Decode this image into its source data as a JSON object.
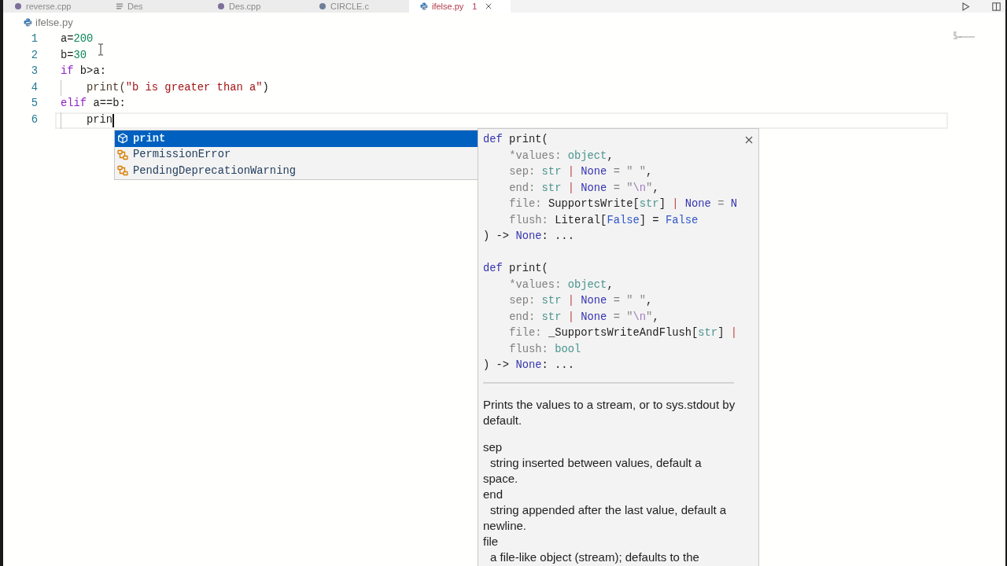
{
  "tabs": [
    {
      "label": "reverse.cpp",
      "kind": "cpp",
      "selected": false
    },
    {
      "label": "Des",
      "kind": "text",
      "selected": false
    },
    {
      "label": "Des.cpp",
      "kind": "cpp",
      "selected": false
    },
    {
      "label": "CIRCLE.c",
      "kind": "c",
      "selected": false
    },
    {
      "label": "ifelse.py",
      "kind": "python",
      "selected": true,
      "problems": "1"
    }
  ],
  "breadcrumb": {
    "file": "ifelse.py"
  },
  "editor": {
    "lines": [
      {
        "number": "1",
        "current": false,
        "indented": false,
        "tokens": [
          {
            "text": "a=",
            "kind": "plain"
          },
          {
            "text": "200",
            "kind": "number"
          }
        ]
      },
      {
        "number": "2",
        "current": false,
        "indented": false,
        "tokens": [
          {
            "text": "b=",
            "kind": "plain"
          },
          {
            "text": "30",
            "kind": "number"
          }
        ]
      },
      {
        "number": "3",
        "current": false,
        "indented": false,
        "tokens": [
          {
            "text": "if",
            "kind": "keyword"
          },
          {
            "text": " b>a:",
            "kind": "plain"
          }
        ]
      },
      {
        "number": "4",
        "current": false,
        "indented": true,
        "tokens": [
          {
            "text": "print(",
            "kind": "function"
          },
          {
            "text": "\"b is greater than a\"",
            "kind": "string"
          },
          {
            "text": ")",
            "kind": "plain"
          }
        ]
      },
      {
        "number": "5",
        "current": false,
        "indented": false,
        "tokens": [
          {
            "text": "elif",
            "kind": "keyword"
          },
          {
            "text": " a==b:",
            "kind": "plain"
          }
        ]
      },
      {
        "number": "6",
        "current": true,
        "indented": true,
        "tokens": [
          {
            "text": "prin",
            "kind": "plain"
          }
        ]
      }
    ]
  },
  "suggest_widget": {
    "items": [
      {
        "label": "print",
        "kind": "function",
        "selected": true
      },
      {
        "label": "PermissionError",
        "kind": "class",
        "selected": false
      },
      {
        "label": "PendingDeprecationWarning",
        "kind": "class",
        "selected": false
      }
    ]
  },
  "details_panel": {
    "signatures": [
      {
        "lines": [
          {
            "indented": false,
            "tokens": [
              {
                "text": "def",
                "kind": "keyword"
              },
              {
                "text": " print(",
                "kind": "plain"
              }
            ]
          },
          {
            "indented": true,
            "tokens": [
              {
                "text": "*values: ",
                "kind": "param"
              },
              {
                "text": "object",
                "kind": "type"
              },
              {
                "text": ",",
                "kind": "plain"
              }
            ]
          },
          {
            "indented": true,
            "tokens": [
              {
                "text": "sep: ",
                "kind": "param"
              },
              {
                "text": "str",
                "kind": "type"
              },
              {
                "text": " | ",
                "kind": "op"
              },
              {
                "text": "None",
                "kind": "keyword"
              },
              {
                "text": " = ",
                "kind": "punct"
              },
              {
                "text": "\" \"",
                "kind": "string"
              },
              {
                "text": ",",
                "kind": "plain"
              }
            ]
          },
          {
            "indented": true,
            "tokens": [
              {
                "text": "end: ",
                "kind": "param"
              },
              {
                "text": "str",
                "kind": "type"
              },
              {
                "text": " | ",
                "kind": "op"
              },
              {
                "text": "None",
                "kind": "keyword"
              },
              {
                "text": " = ",
                "kind": "punct"
              },
              {
                "text": "\"",
                "kind": "string"
              },
              {
                "text": "\\n",
                "kind": "escape"
              },
              {
                "text": "\"",
                "kind": "string"
              },
              {
                "text": ",",
                "kind": "plain"
              }
            ]
          },
          {
            "indented": true,
            "tokens": [
              {
                "text": "file: ",
                "kind": "param"
              },
              {
                "text": "SupportsWrite[",
                "kind": "plain"
              },
              {
                "text": "str",
                "kind": "type"
              },
              {
                "text": "]",
                "kind": "plain"
              },
              {
                "text": " | ",
                "kind": "op"
              },
              {
                "text": "None",
                "kind": "keyword"
              },
              {
                "text": " = ",
                "kind": "punct"
              },
              {
                "text": "N",
                "kind": "keyword"
              }
            ]
          },
          {
            "indented": true,
            "tokens": [
              {
                "text": "flush: ",
                "kind": "param"
              },
              {
                "text": "Literal[",
                "kind": "plain"
              },
              {
                "text": "False",
                "kind": "constant"
              },
              {
                "text": "] = ",
                "kind": "plain"
              },
              {
                "text": "False",
                "kind": "constant"
              }
            ]
          },
          {
            "indented": false,
            "tokens": [
              {
                "text": ") -> ",
                "kind": "plain"
              },
              {
                "text": "None",
                "kind": "keyword"
              },
              {
                "text": ": ...",
                "kind": "plain"
              }
            ]
          }
        ]
      },
      {
        "lines": [
          {
            "indented": false,
            "tokens": [
              {
                "text": "def",
                "kind": "keyword"
              },
              {
                "text": " print(",
                "kind": "plain"
              }
            ]
          },
          {
            "indented": true,
            "tokens": [
              {
                "text": "*values: ",
                "kind": "param"
              },
              {
                "text": "object",
                "kind": "type"
              },
              {
                "text": ",",
                "kind": "plain"
              }
            ]
          },
          {
            "indented": true,
            "tokens": [
              {
                "text": "sep: ",
                "kind": "param"
              },
              {
                "text": "str",
                "kind": "type"
              },
              {
                "text": " | ",
                "kind": "op"
              },
              {
                "text": "None",
                "kind": "keyword"
              },
              {
                "text": " = ",
                "kind": "punct"
              },
              {
                "text": "\" \"",
                "kind": "string"
              },
              {
                "text": ",",
                "kind": "plain"
              }
            ]
          },
          {
            "indented": true,
            "tokens": [
              {
                "text": "end: ",
                "kind": "param"
              },
              {
                "text": "str",
                "kind": "type"
              },
              {
                "text": " | ",
                "kind": "op"
              },
              {
                "text": "None",
                "kind": "keyword"
              },
              {
                "text": " = ",
                "kind": "punct"
              },
              {
                "text": "\"",
                "kind": "string"
              },
              {
                "text": "\\n",
                "kind": "escape"
              },
              {
                "text": "\"",
                "kind": "string"
              },
              {
                "text": ",",
                "kind": "plain"
              }
            ]
          },
          {
            "indented": true,
            "tokens": [
              {
                "text": "file: ",
                "kind": "param"
              },
              {
                "text": "_SupportsWriteAndFlush[",
                "kind": "plain"
              },
              {
                "text": "str",
                "kind": "type"
              },
              {
                "text": "] ",
                "kind": "plain"
              },
              {
                "text": "|",
                "kind": "op"
              }
            ]
          },
          {
            "indented": true,
            "tokens": [
              {
                "text": "flush: ",
                "kind": "param"
              },
              {
                "text": "bool",
                "kind": "type"
              }
            ]
          },
          {
            "indented": false,
            "tokens": [
              {
                "text": ") -> ",
                "kind": "plain"
              },
              {
                "text": "None",
                "kind": "keyword"
              },
              {
                "text": ": ...",
                "kind": "plain"
              }
            ]
          }
        ]
      }
    ],
    "documentation": {
      "summary": "Prints the values to a stream, or to sys.stdout by default.",
      "params": [
        {
          "name": "sep",
          "description": "string inserted between values, default a space."
        },
        {
          "name": "end",
          "description": "string appended after the last value, default a newline."
        },
        {
          "name": "file",
          "description": "a file-like object (stream); defaults to the"
        }
      ]
    }
  }
}
